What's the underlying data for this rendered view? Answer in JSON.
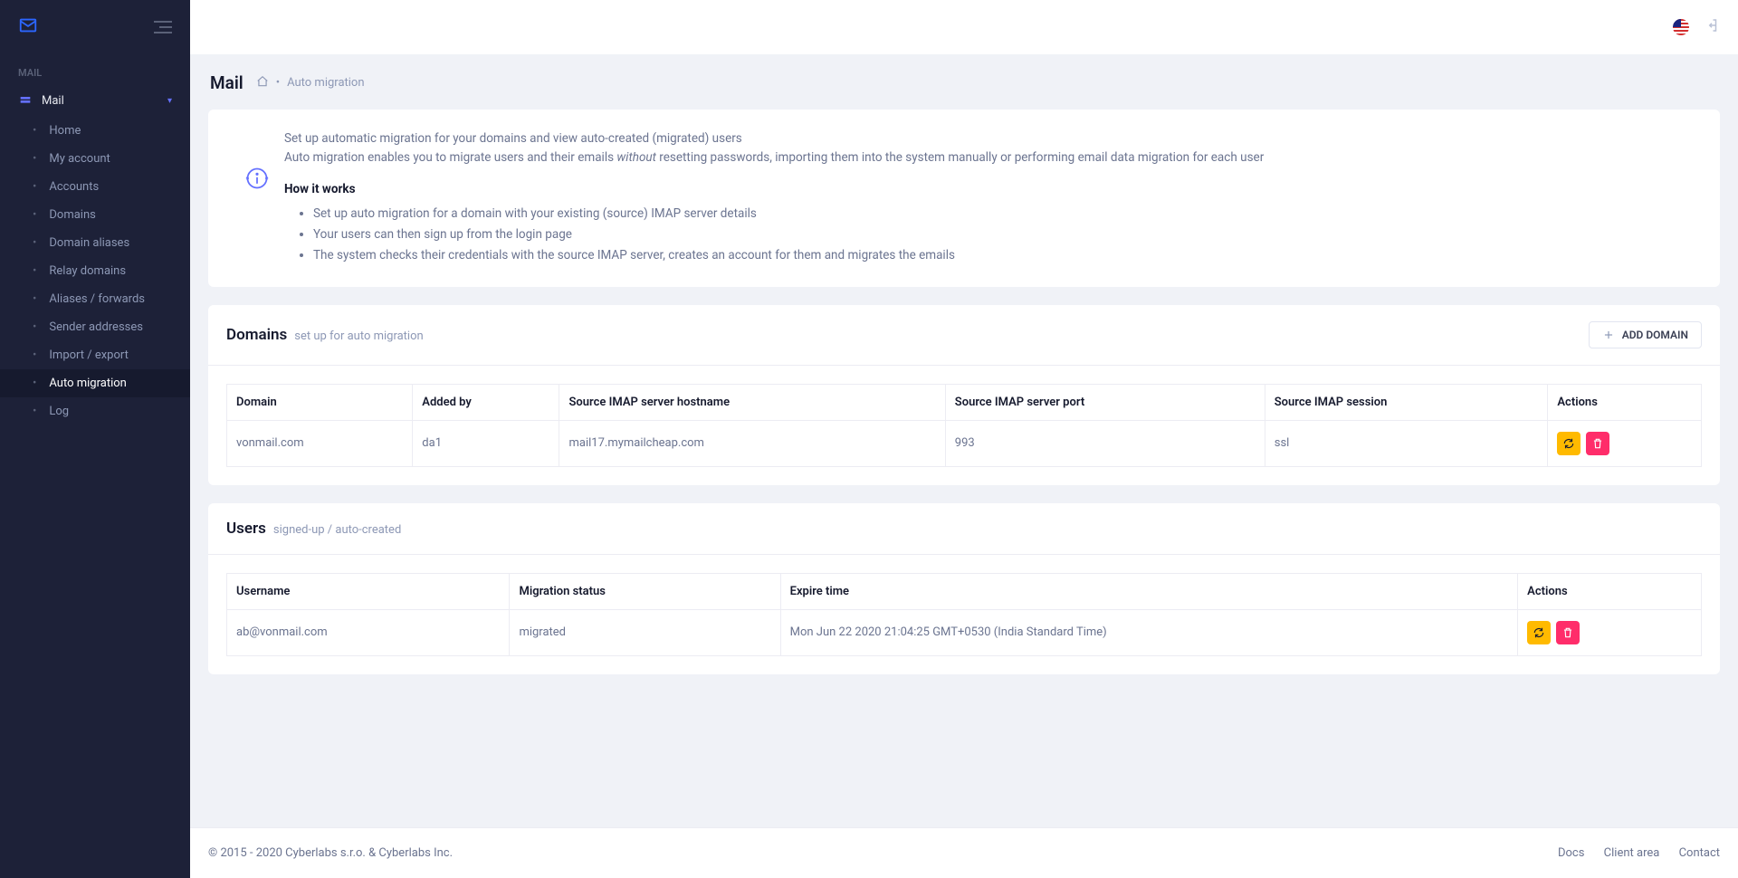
{
  "sidebar": {
    "section": "MAIL",
    "main_label": "Mail",
    "items": [
      "Home",
      "My account",
      "Accounts",
      "Domains",
      "Domain aliases",
      "Relay domains",
      "Aliases / forwards",
      "Sender addresses",
      "Import / export",
      "Auto migration",
      "Log"
    ],
    "active_index": 9
  },
  "page": {
    "title": "Mail",
    "breadcrumb_sep": "•",
    "breadcrumb_current": "Auto migration"
  },
  "intro": {
    "line1": "Set up automatic migration for your domains and view auto-created (migrated) users",
    "line2a": "Auto migration enables you to migrate users and their emails ",
    "line2_em": "without",
    "line2b": " resetting passwords, importing them into the system manually or performing email data migration for each user",
    "how_title": "How it works",
    "bullets": [
      "Set up auto migration for a domain with your existing (source) IMAP server details",
      "Your users can then sign up from the login page",
      "The system checks their credentials with the source IMAP server, creates an account for them and migrates the emails"
    ]
  },
  "domains_section": {
    "title": "Domains",
    "subtitle": "set up for auto migration",
    "add_label": "ADD DOMAIN",
    "columns": [
      "Domain",
      "Added by",
      "Source IMAP server hostname",
      "Source IMAP server port",
      "Source IMAP session",
      "Actions"
    ],
    "rows": [
      {
        "domain": "vonmail.com",
        "added_by": "da1",
        "host": "mail17.mymailcheap.com",
        "port": "993",
        "session": "ssl"
      }
    ]
  },
  "users_section": {
    "title": "Users",
    "subtitle": "signed-up / auto-created",
    "columns": [
      "Username",
      "Migration status",
      "Expire time",
      "Actions"
    ],
    "rows": [
      {
        "username": "ab@vonmail.com",
        "status": "migrated",
        "expire": "Mon Jun 22 2020 21:04:25 GMT+0530 (India Standard Time)"
      }
    ]
  },
  "footer": {
    "copy": "© 2015 - 2020 Cyberlabs s.r.o. & Cyberlabs Inc.",
    "links": [
      "Docs",
      "Client area",
      "Contact"
    ]
  }
}
